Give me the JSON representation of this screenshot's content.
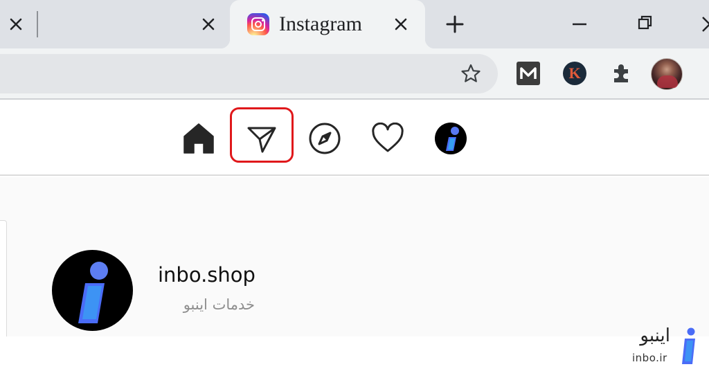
{
  "browser": {
    "active_tab": {
      "title": "Instagram",
      "favicon": "instagram-icon"
    },
    "new_tab_icon": "plus-icon",
    "window_controls": [
      "minimize-icon",
      "restore-icon",
      "close-icon"
    ],
    "toolbar": {
      "bookmark_icon": "star-icon",
      "extensions": [
        "m-extension-icon",
        "k-extension-icon",
        "puzzle-extensions-icon",
        "profile-avatar"
      ],
      "k_letter": "K"
    }
  },
  "instagram": {
    "nav": {
      "items": [
        "home-icon",
        "direct-message-icon",
        "explore-icon",
        "activity-heart-icon",
        "profile-avatar"
      ],
      "highlighted": "direct-message-icon",
      "highlight_color": "#e0181b"
    },
    "profile": {
      "username": "inbo.shop",
      "full_name": "خدمات اینبو"
    }
  },
  "watermark": {
    "name_fa": "اینبو",
    "url": "inbo.ir"
  },
  "colors": {
    "tabstrip": "#dee1e6",
    "toolbar": "#f1f3f4",
    "brand_blue": "#4a6cf7",
    "highlight": "#e0181b"
  }
}
